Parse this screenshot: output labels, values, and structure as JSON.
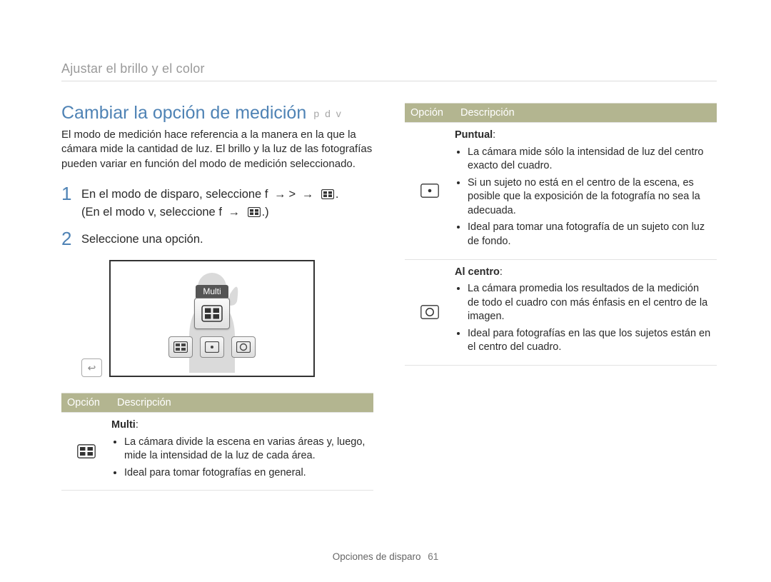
{
  "breadcrumb": "Ajustar el brillo y el color",
  "heading": "Cambiar la opción de medición",
  "heading_modes": "p d v",
  "intro": "El modo de medición hace referencia a la manera en la que la cámara mide la cantidad de luz. El brillo y la luz de las fotografías pueden variar en función del modo de medición seleccionado.",
  "steps": {
    "s1": {
      "num": "1",
      "ln1_a": "En el modo de disparo, seleccione ",
      "ln1_f": "f",
      "ln1_arrow1": "→",
      "ln1_gt": ">",
      "ln1_arrow2": "→",
      "ln1_end": ".",
      "ln2_a": "En el modo ",
      "ln2_v": "v",
      "ln2_b": ", seleccione ",
      "ln2_f": "f",
      "ln2_arrow": "→",
      "ln2_close": ".)"
    },
    "s2": {
      "num": "2",
      "text": "Seleccione una opción."
    }
  },
  "screen": {
    "multi_label": "Multi",
    "back_glyph": "↩"
  },
  "table_header": {
    "col1": "Opción",
    "col2": "Descripción"
  },
  "options": {
    "multi": {
      "title": "Multi",
      "colon": ":",
      "b1": "La cámara divide la escena en varias áreas y, luego, mide la intensidad de la luz de cada área.",
      "b2": "Ideal para tomar fotografías en general."
    },
    "puntual": {
      "title": "Puntual",
      "colon": ":",
      "b1": "La cámara mide sólo la intensidad de luz del centro exacto del cuadro.",
      "b2": "Si un sujeto no está en el centro de la escena, es posible que la exposición de la fotografía no sea la adecuada.",
      "b3": "Ideal para tomar una fotografía de un sujeto con luz de fondo."
    },
    "alcentro": {
      "title": "Al centro",
      "colon": ":",
      "b1": "La cámara promedia los resultados de la medición de todo el cuadro con más énfasis en el centro de la imagen.",
      "b2": "Ideal para fotografías en las que los sujetos están en el centro del cuadro."
    }
  },
  "footer": {
    "section": "Opciones de disparo",
    "page": "61"
  }
}
